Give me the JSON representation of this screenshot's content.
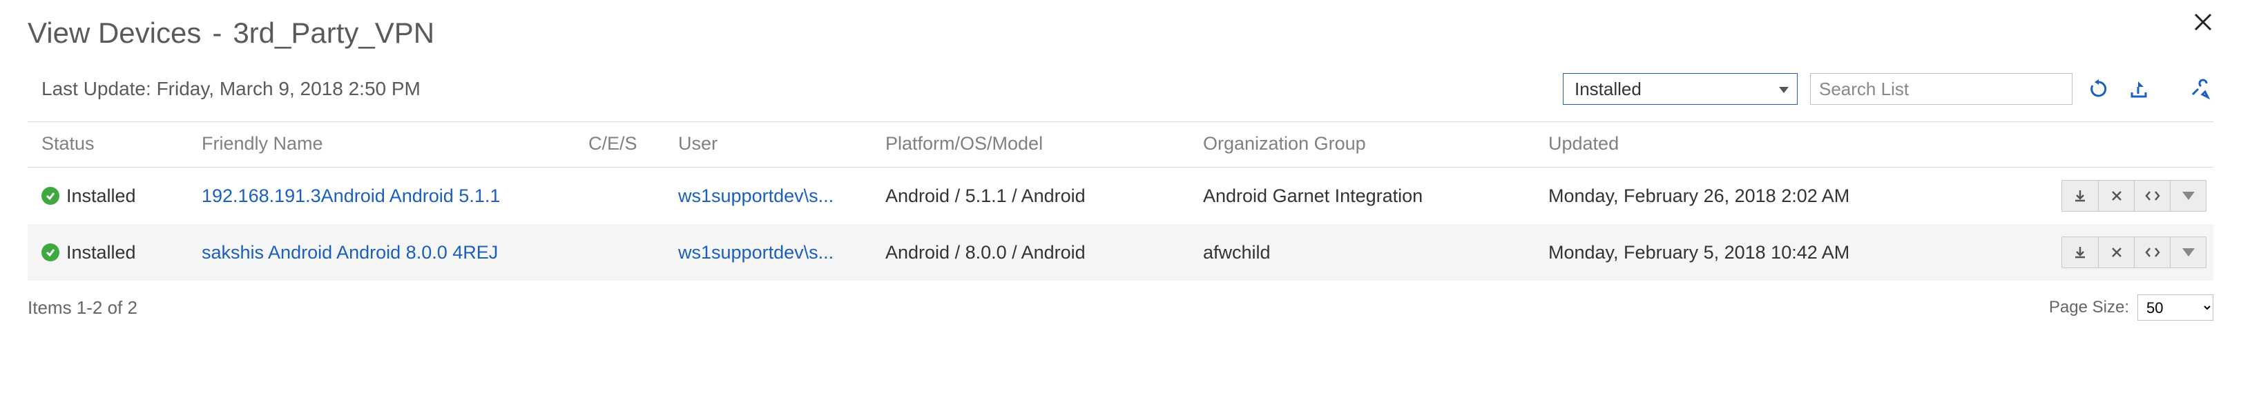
{
  "header": {
    "title_prefix": "View Devices",
    "title_dash": "-",
    "title_name": "3rd_Party_VPN"
  },
  "subheader": {
    "last_update_label": "Last Update:",
    "last_update_value": "Friday, March 9, 2018 2:50 PM"
  },
  "controls": {
    "filter_selected": "Installed",
    "search_placeholder": "Search List"
  },
  "columns": {
    "status": "Status",
    "friendly_name": "Friendly Name",
    "ces": "C/E/S",
    "user": "User",
    "platform": "Platform/OS/Model",
    "org": "Organization Group",
    "updated": "Updated"
  },
  "rows": [
    {
      "status": "Installed",
      "friendly_name": "192.168.191.3Android Android 5.1.1",
      "ces": "",
      "user": "ws1supportdev\\s...",
      "platform": "Android / 5.1.1 / Android",
      "org": "Android Garnet Integration",
      "updated": "Monday, February 26, 2018 2:02 AM"
    },
    {
      "status": "Installed",
      "friendly_name": "sakshis Android Android 8.0.0 4REJ",
      "ces": "",
      "user": "ws1supportdev\\s...",
      "platform": "Android / 8.0.0 / Android",
      "org": "afwchild",
      "updated": "Monday, February 5, 2018 10:42 AM"
    }
  ],
  "footer": {
    "items_text": "Items 1-2 of 2",
    "page_size_label": "Page Size:",
    "page_size_value": "50"
  }
}
